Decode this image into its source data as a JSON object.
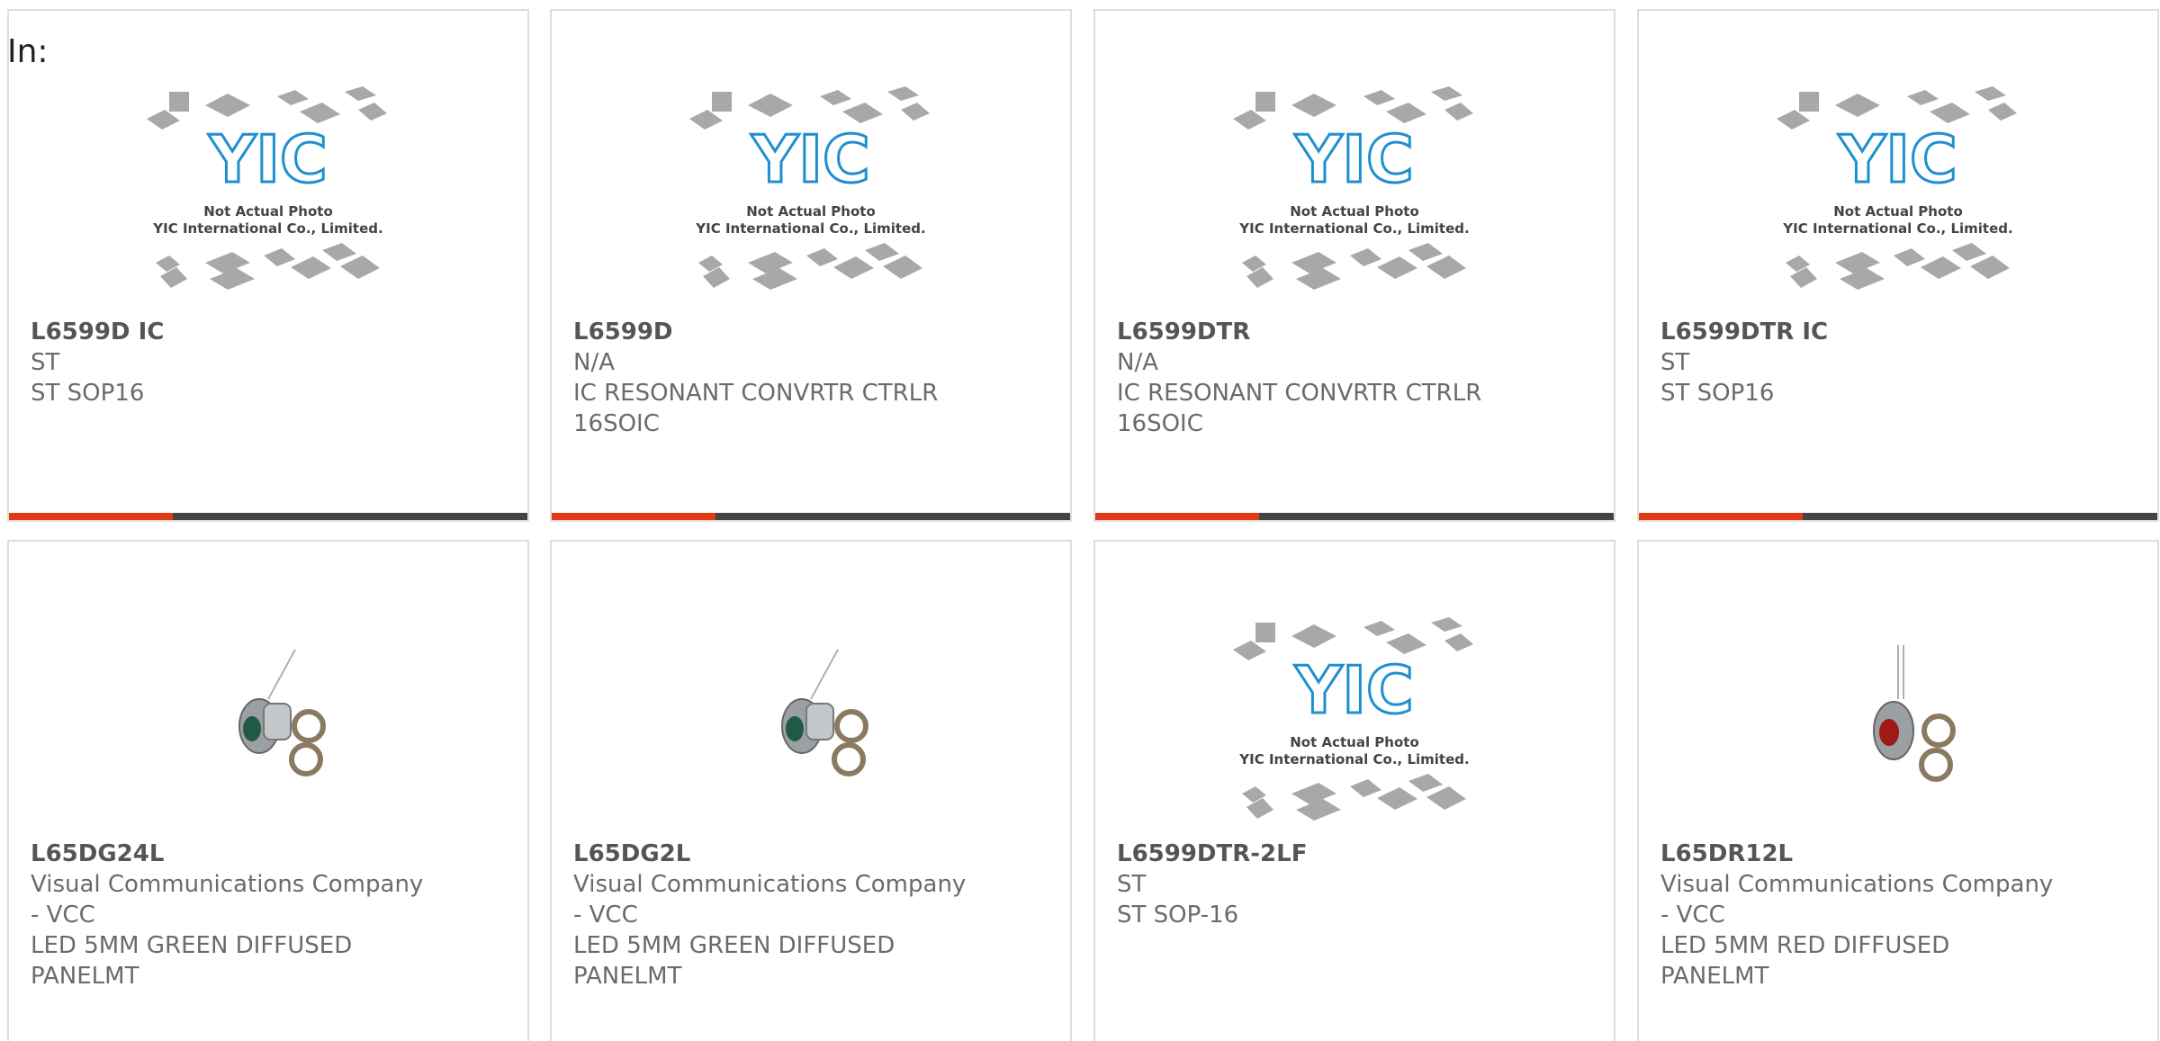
{
  "header": {
    "prefix": "In:"
  },
  "colors": {
    "accent": "#e23a12",
    "bar": "#444444",
    "text": "#6b6b6b",
    "border": "#dddddd"
  },
  "placeholder": {
    "logo": "YIC",
    "line1": "Not Actual Photo",
    "line2": "YIC International Co., Limited."
  },
  "products": [
    {
      "part": "L6599D IC",
      "line1": "ST",
      "line2": "ST SOP16",
      "line3": "",
      "image": "placeholder"
    },
    {
      "part": "L6599D",
      "line1": "N/A",
      "line2": "IC RESONANT CONVRTR CTRLR",
      "line3": "16SOIC",
      "image": "placeholder"
    },
    {
      "part": "L6599DTR",
      "line1": "N/A",
      "line2": "IC RESONANT CONVRTR CTRLR",
      "line3": "16SOIC",
      "image": "placeholder"
    },
    {
      "part": "L6599DTR IC",
      "line1": "ST",
      "line2": "ST SOP16",
      "line3": "",
      "image": "placeholder"
    },
    {
      "part": "L65DG24L",
      "line1": "Visual Communications Company",
      "line2": "- VCC",
      "line3": "LED 5MM GREEN DIFFUSED",
      "line4": "PANELMT",
      "image": "led-green"
    },
    {
      "part": "L65DG2L",
      "line1": "Visual Communications Company",
      "line2": "- VCC",
      "line3": "LED 5MM GREEN DIFFUSED",
      "line4": "PANELMT",
      "image": "led-green"
    },
    {
      "part": "L6599DTR-2LF",
      "line1": "ST",
      "line2": "ST SOP-16",
      "line3": "",
      "image": "placeholder"
    },
    {
      "part": "L65DR12L",
      "line1": "Visual Communications Company",
      "line2": "- VCC",
      "line3": "LED 5MM RED DIFFUSED",
      "line4": "PANELMT",
      "image": "led-red"
    }
  ]
}
